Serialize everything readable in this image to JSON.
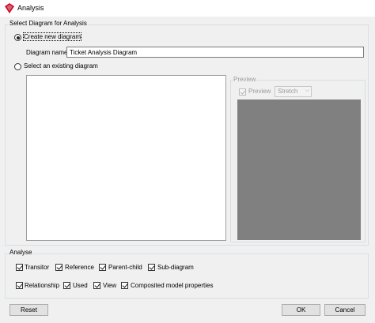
{
  "window": {
    "title": "Analysis",
    "icon": "visual-paradigm-logo-icon",
    "accent": "#c8102e"
  },
  "select_group": {
    "legend": "Select Diagram for Analysis",
    "create_new_label": "Create new diagram",
    "diagram_name_label": "Diagram name:",
    "diagram_name_value": "Ticket Analysis Diagram",
    "select_existing_label": "Select an existing diagram",
    "selected_option": "create_new"
  },
  "preview": {
    "legend": "Preview",
    "checkbox_label": "Preview",
    "mode_value": "Stretch"
  },
  "analyse": {
    "legend": "Analyse",
    "options": [
      {
        "label": "Transitor",
        "checked": true
      },
      {
        "label": "Reference",
        "checked": true
      },
      {
        "label": "Parent-child",
        "checked": true
      },
      {
        "label": "Sub-diagram",
        "checked": true
      },
      {
        "label": "Relationship",
        "checked": true
      },
      {
        "label": "Used",
        "checked": true
      },
      {
        "label": "View",
        "checked": true
      },
      {
        "label": "Composited model properties",
        "checked": true
      }
    ]
  },
  "buttons": {
    "reset": "Reset",
    "ok": "OK",
    "cancel": "Cancel"
  }
}
